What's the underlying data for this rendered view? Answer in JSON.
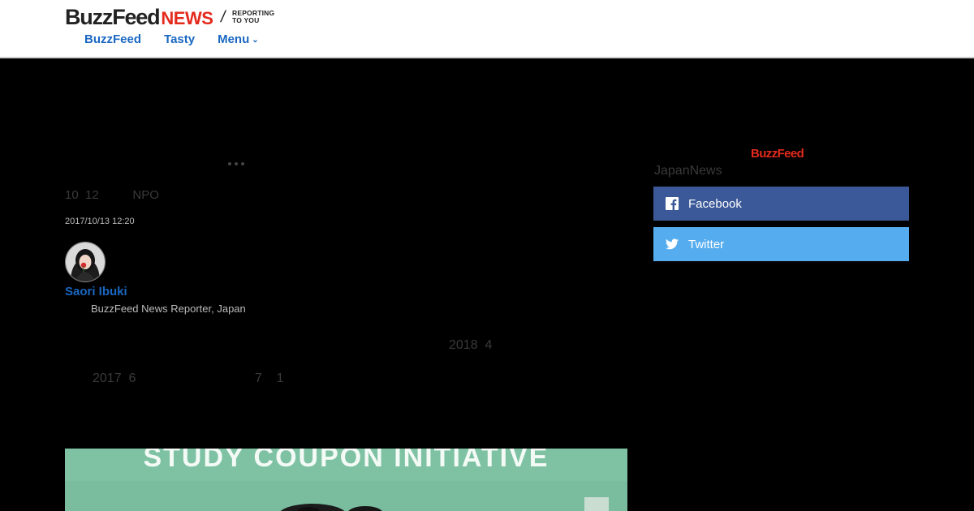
{
  "header": {
    "logo_buzzfeed": "BuzzFeed",
    "logo_news": "NEWS",
    "logo_slash": "/",
    "tagline_line1": "REPORTING",
    "tagline_line2": "TO YOU",
    "nav": {
      "buzzfeed": "BuzzFeed",
      "tasty": "Tasty",
      "menu": "Menu"
    }
  },
  "article": {
    "subtitle": "10  12          NPO",
    "timestamp": "2017/10/13 12:20",
    "author_name": "Saori Ibuki",
    "author_role": "BuzzFeed News Reporter, Japan",
    "body_line1": "2018  4",
    "body_line2_a": "2017  6",
    "body_line2_b": "7    1",
    "hero_text": "STUDY COUPON INITIATIVE"
  },
  "sidebar": {
    "logo": "BuzzFeed",
    "title": "JapanNews",
    "facebook_label": "Facebook",
    "twitter_label": "Twitter"
  },
  "colors": {
    "link_blue": "#1a67c2",
    "news_red": "#e32a1d",
    "facebook": "#3b5998",
    "twitter": "#55acee"
  }
}
